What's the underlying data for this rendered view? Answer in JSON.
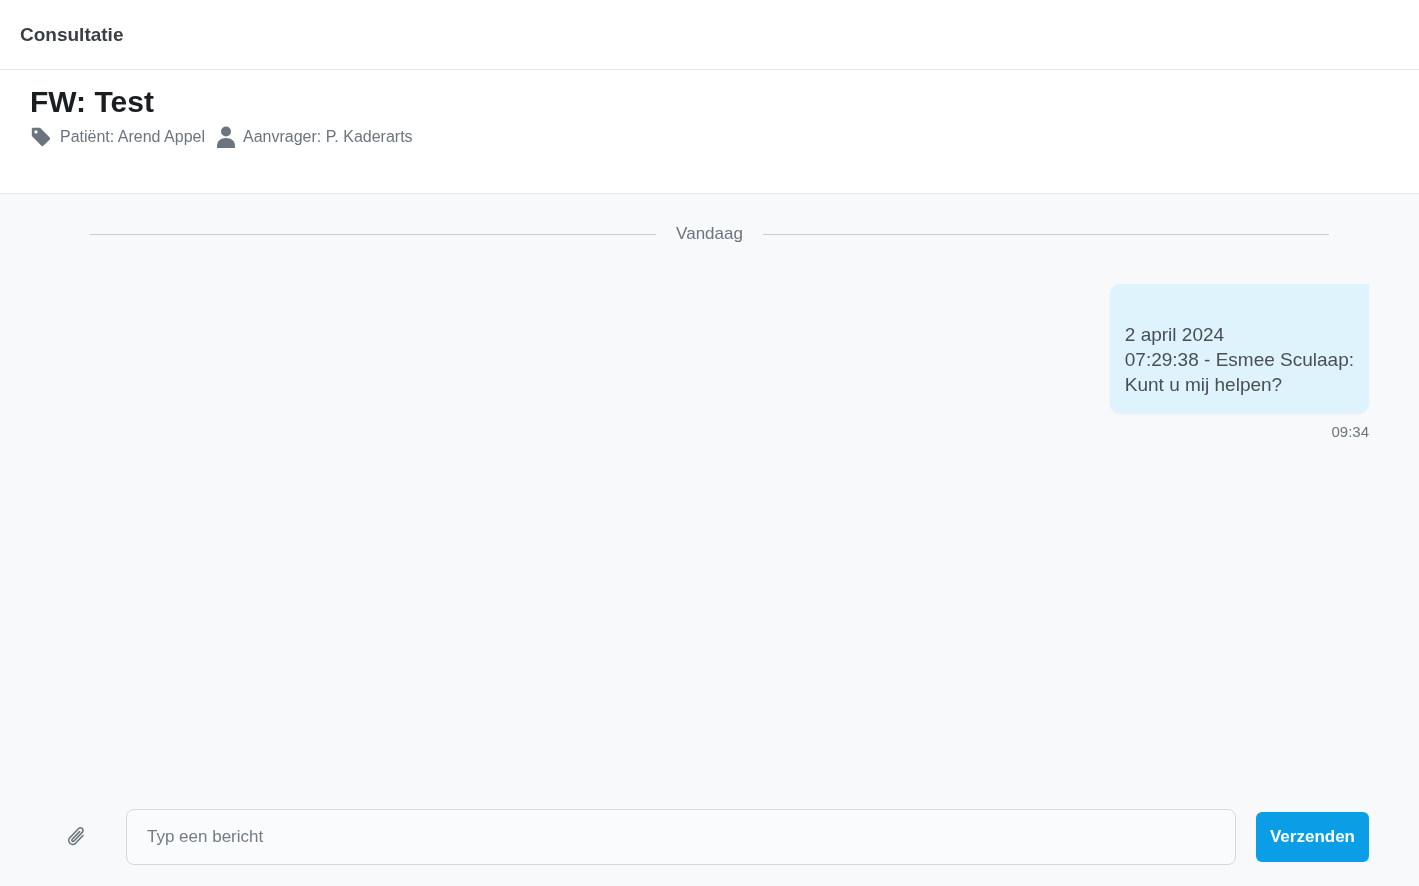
{
  "header": {
    "title": "Consultatie"
  },
  "conversation": {
    "subject": "FW: Test",
    "meta": [
      {
        "kind": "tag",
        "text": "Patiënt: Arend Appel"
      },
      {
        "kind": "person",
        "text": "Aanvrager: P. Kaderarts"
      }
    ]
  },
  "day_separator": "Vandaag",
  "messages": [
    {
      "text": "2 april 2024\n07:29:38 - Esmee Sculaap:\nKunt u mij helpen?",
      "time": "09:34"
    }
  ],
  "composer": {
    "placeholder": "Typ een bericht",
    "send_label": "Verzenden"
  }
}
